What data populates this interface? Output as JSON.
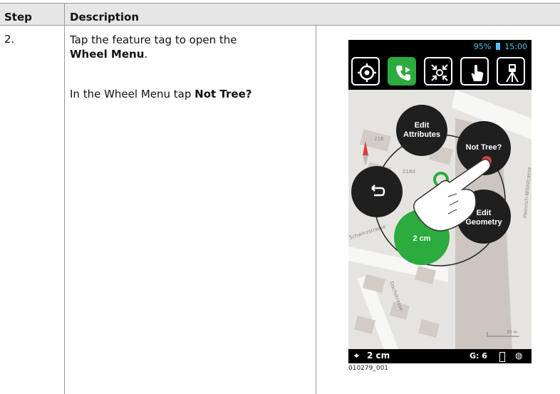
{
  "table": {
    "header": {
      "step": "Step",
      "description": "Description"
    },
    "rows": [
      {
        "step": "2.",
        "line1_pre": "Tap the feature tag to open the",
        "line1_bold": "Wheel Menu",
        "line1_post": ".",
        "line2_pre": "In the Wheel Menu tap",
        "line2_bold": "Not Tree?"
      }
    ]
  },
  "screenshot": {
    "status_bar": {
      "battery": "95%",
      "time": "15:00"
    },
    "toolbar_icons": [
      "crosshair-icon",
      "phone-icon",
      "shrink-icon",
      "hand-tap-icon",
      "instrument-icon"
    ],
    "wheel_menu": {
      "edit_attributes": [
        "Edit",
        "Attributes"
      ],
      "not_tree": "Not Tree?",
      "edit_geometry": [
        "Edit",
        "Geometry"
      ],
      "accuracy_bubble": "2 cm",
      "back_icon": "back-arrow-icon"
    },
    "map_labels": [
      "216",
      "218d",
      "Dachstrasse",
      "Schwinzstrasse",
      "Heinrich-Wildstrasse",
      "20 m"
    ],
    "bottom_bar": {
      "accuracy": "2 cm",
      "gps": "G: 6"
    },
    "caption": "010279_001"
  },
  "colors": {
    "accent_green": "#2cab3e",
    "red_marker": "#e23b3b",
    "header_bg": "#e6e6e6"
  }
}
